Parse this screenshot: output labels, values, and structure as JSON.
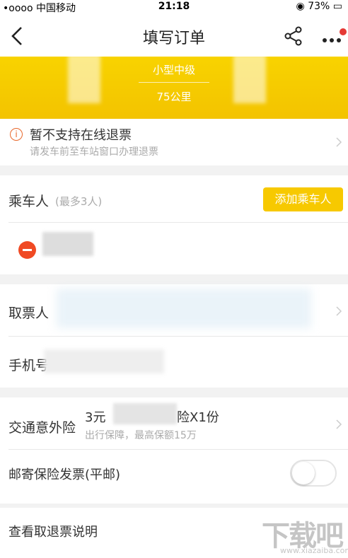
{
  "status_bar": {
    "carrier": "•oooo 中国移动",
    "time": "21:18",
    "battery": "73%"
  },
  "nav": {
    "title": "填写订单"
  },
  "banner": {
    "car_type": "小型中级",
    "distance": "75公里"
  },
  "refund": {
    "title": "暂不支持在线退票",
    "subtitle": "请发车前至车站窗口办理退票",
    "icon": "i"
  },
  "passenger": {
    "label": "乘车人",
    "hint": "(最多3人)",
    "add_button": "添加乘车人"
  },
  "pickup": {
    "label": "取票人",
    "phone_label": "手机号"
  },
  "insurance": {
    "label": "交通意外险",
    "value": "3元",
    "value_tail": "险X1份",
    "desc": "出行保障，最高保额15万"
  },
  "invoice": {
    "label": "邮寄保险发票(平邮)",
    "enabled": false
  },
  "refund_info": {
    "label": "查看取退票说明"
  },
  "watermark": {
    "text": "下载吧",
    "url": "www.xiazaiba.com"
  },
  "colors": {
    "accent": "#f7c900",
    "warning": "#e8672a",
    "remove": "#f04a24"
  }
}
